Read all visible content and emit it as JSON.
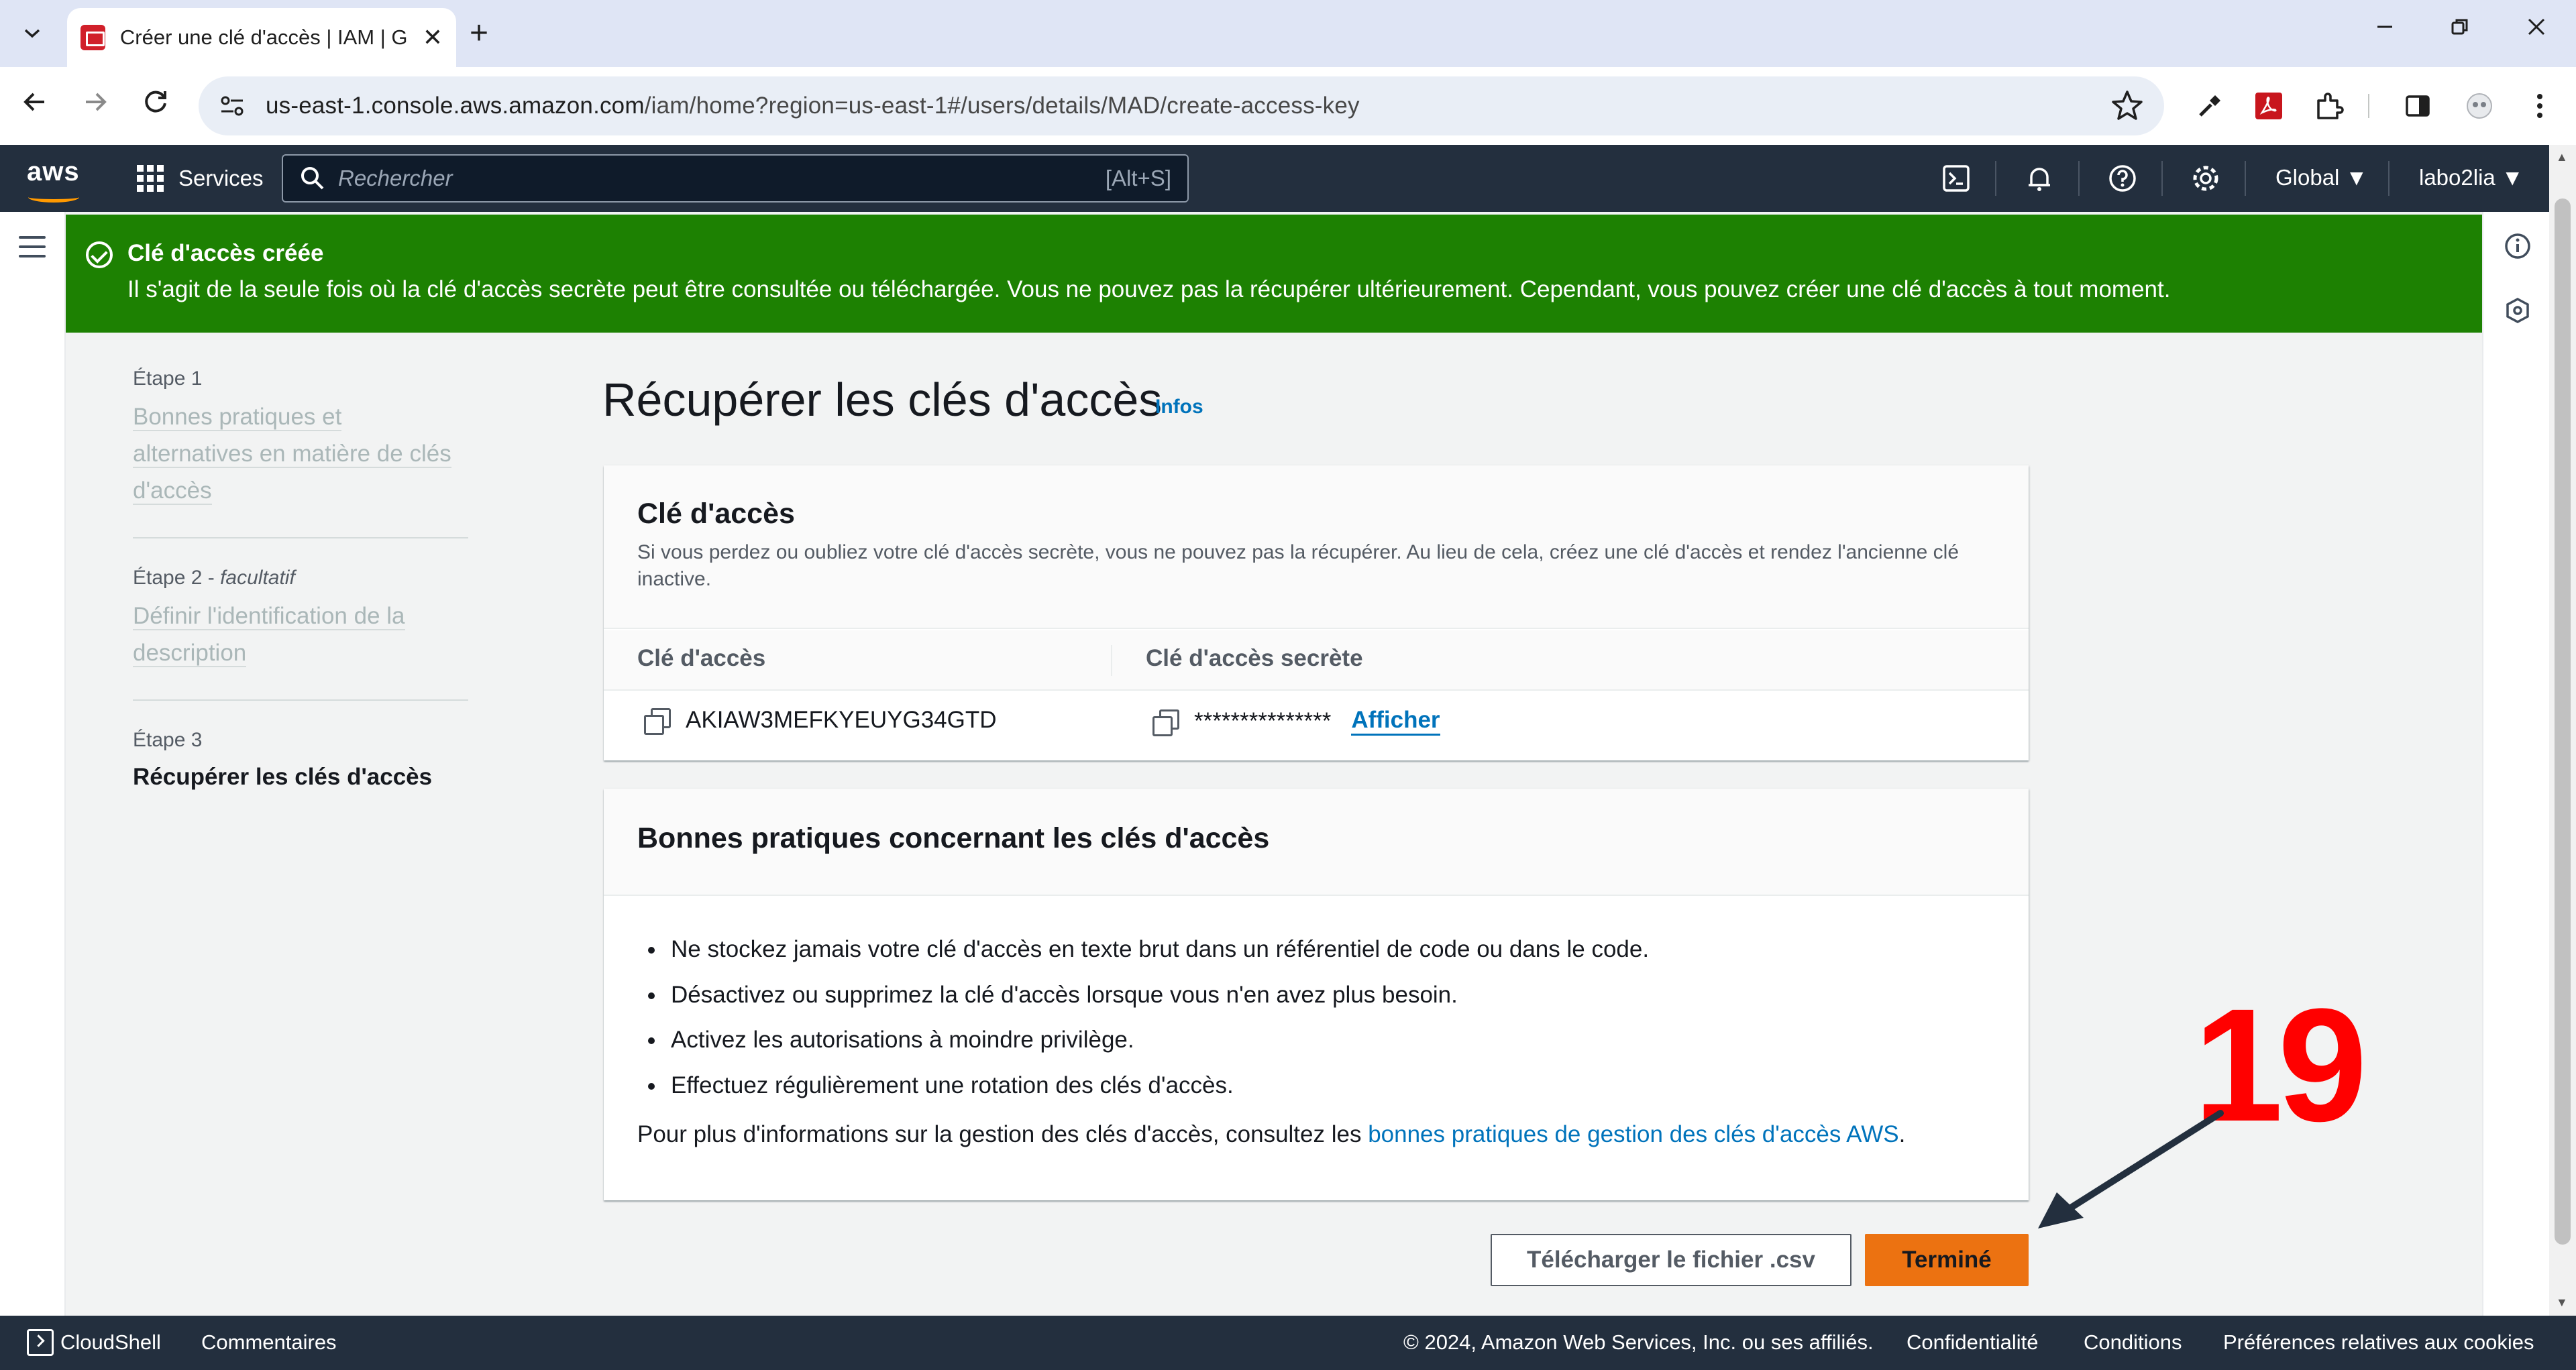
{
  "browser": {
    "tab_title": "Créer une clé d'accès | IAM | Global",
    "new_tab_symbol": "+",
    "close_symbol": "✕",
    "url_host": "us-east-1.console.aws.amazon.com",
    "url_path": "/iam/home?region=us-east-1#/users/details/MAD/create-access-key",
    "icons": [
      "back-icon",
      "forward-icon",
      "reload-icon",
      "site-info-icon",
      "star-icon",
      "eyedropper-icon",
      "pdf-icon",
      "extensions-icon",
      "side-panel-icon",
      "profile-icon",
      "menu-icon"
    ]
  },
  "aws_nav": {
    "logo": "aws",
    "services": "Services",
    "search_placeholder": "Rechercher",
    "search_shortcut": "[Alt+S]",
    "region": "Global ▼",
    "account": "labo2lia ▼"
  },
  "flash": {
    "title": "Clé d'accès créée",
    "message": "Il s'agit de la seule fois où la clé d'accès secrète peut être consultée ou téléchargée. Vous ne pouvez pas la récupérer ultérieurement. Cependant, vous pouvez créer une clé d'accès à tout moment.",
    "color": "#1d8102"
  },
  "steps": {
    "step1_label": "Étape 1",
    "step1_text": "Bonnes pratiques et alternatives en matière de clés d'accès",
    "step2_label": "Étape 2 - ",
    "step2_optional": "facultatif",
    "step2_text": "Définir l'identification de la description",
    "step3_label": "Étape 3",
    "step3_text": "Récupérer les clés d'accès"
  },
  "page": {
    "title": "Récupérer les clés d'accès",
    "info_link": "Infos"
  },
  "access_key_card": {
    "title": "Clé d'accès",
    "description": "Si vous perdez ou oubliez votre clé d'accès secrète, vous ne pouvez pas la récupérer. Au lieu de cela, créez une clé d'accès et rendez l'ancienne clé inactive.",
    "col_key": "Clé d'accès",
    "col_secret": "Clé d'accès secrète",
    "access_key_value": "AKIAW3MEFKYEUYG34GTD",
    "secret_masked": "***************",
    "show_link": "Afficher"
  },
  "best_practices_card": {
    "title": "Bonnes pratiques concernant les clés d'accès",
    "items": [
      "Ne stockez jamais votre clé d'accès en texte brut dans un référentiel de code ou dans le code.",
      "Désactivez ou supprimez la clé d'accès lorsque vous n'en avez plus besoin.",
      "Activez les autorisations à moindre privilège.",
      "Effectuez régulièrement une rotation des clés d'accès."
    ],
    "more_info_prefix": "Pour plus d'informations sur la gestion des clés d'accès, consultez les ",
    "more_info_link": "bonnes pratiques de gestion des clés d'accès AWS",
    "more_info_suffix": "."
  },
  "actions": {
    "download_csv": "Télécharger le fichier .csv",
    "done": "Terminé"
  },
  "annotation": {
    "step_number": "19",
    "color": "#ff0000"
  },
  "footer": {
    "cloudshell": "CloudShell",
    "feedback": "Commentaires",
    "copyright": "© 2024, Amazon Web Services, Inc. ou ses affiliés.",
    "privacy": "Confidentialité",
    "terms": "Conditions",
    "cookies": "Préférences relatives aux cookies"
  }
}
